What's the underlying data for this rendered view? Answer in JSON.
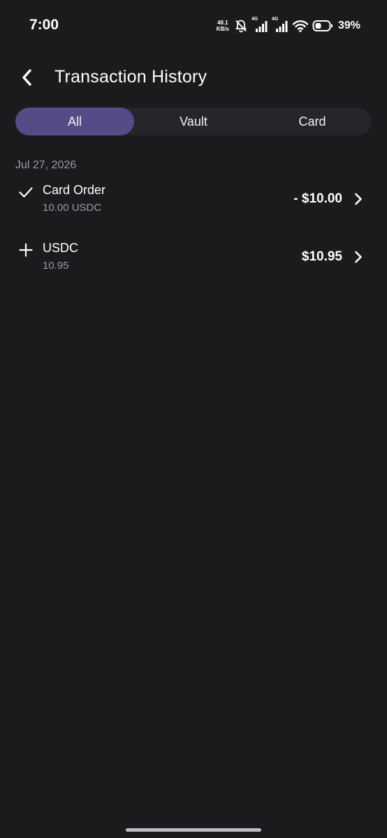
{
  "status_bar": {
    "time": "7:00",
    "net_speed_value": "48.1",
    "net_speed_unit": "KB/s",
    "sim1_tag": "4G",
    "sim2_tag": "4G",
    "battery_percent": "39%"
  },
  "header": {
    "title": "Transaction History",
    "back_icon": "chevron-left-icon"
  },
  "tabs": [
    {
      "label": "All",
      "active": true
    },
    {
      "label": "Vault",
      "active": false
    },
    {
      "label": "Card",
      "active": false
    }
  ],
  "transactions": {
    "date": "Jul 27, 2026",
    "items": [
      {
        "icon": "check-icon",
        "title": "Card Order",
        "subtitle": "10.00 USDC",
        "amount": "- $10.00"
      },
      {
        "icon": "plus-icon",
        "title": "USDC",
        "subtitle": "10.95",
        "amount": "$10.95"
      }
    ]
  },
  "colors": {
    "background": "#1b1a1d",
    "tab_track": "#262529",
    "tab_active": "#544c86",
    "secondary_text": "#9c9ba2"
  }
}
